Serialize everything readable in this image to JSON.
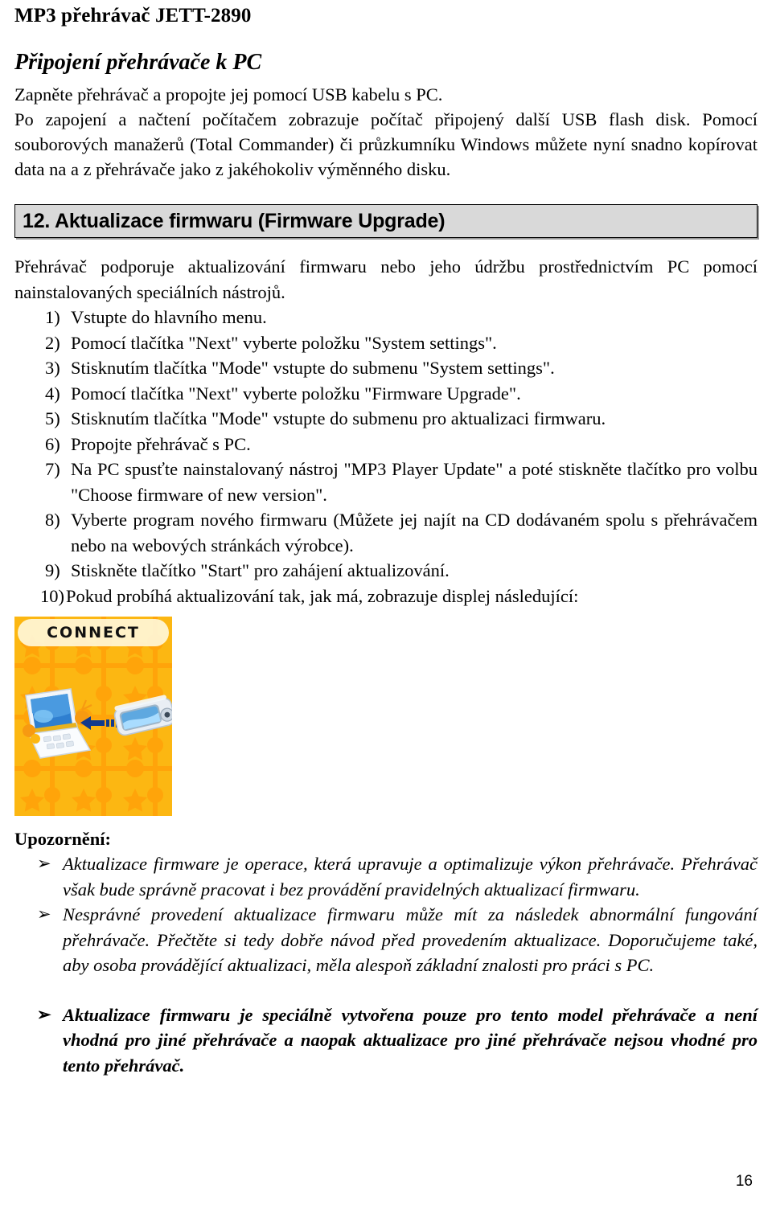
{
  "header": {
    "running_title": "MP3 přehrávač JETT-2890"
  },
  "section_connect": {
    "title": "Připojení přehrávače k PC",
    "paragraph_1": "Zapněte přehrávač a propojte jej pomocí USB kabelu s PC.",
    "paragraph_2": "Po zapojení a načtení počítačem zobrazuje počítač připojený další USB flash disk. Pomocí souborových manažerů (Total Commander) či průzkumníku Windows můžete nyní snadno kopírovat data na a z přehrávače jako z jakéhokoliv výměnného disku."
  },
  "section_firmware": {
    "banner_label": "12. Aktualizace firmwaru (Firmware Upgrade)",
    "intro": "Přehrávač podporuje aktualizování firmwaru nebo jeho údržbu prostřednictvím PC pomocí nainstalovaných speciálních nástrojů.",
    "steps": [
      {
        "marker": "1)",
        "text": "Vstupte do hlavního menu."
      },
      {
        "marker": "2)",
        "text": "Pomocí tlačítka \"Next\" vyberte položku \"System settings\"."
      },
      {
        "marker": "3)",
        "text": "Stisknutím tlačítka \"Mode\" vstupte do submenu \"System settings\"."
      },
      {
        "marker": "4)",
        "text": "Pomocí tlačítka \"Next\" vyberte položku \"Firmware Upgrade\"."
      },
      {
        "marker": "5)",
        "text": "Stisknutím tlačítka \"Mode\" vstupte do submenu pro aktualizaci firmwaru."
      },
      {
        "marker": "6)",
        "text": "Propojte přehrávač s PC."
      },
      {
        "marker": "7)",
        "text": "Na PC spusťte nainstalovaný nástroj \"MP3 Player Update\" a poté stiskněte tlačítko pro volbu \"Choose firmware of new version\"."
      },
      {
        "marker": "8)",
        "text": "Vyberte program nového firmwaru (Můžete jej najít na CD dodávaném spolu s přehrávačem nebo na webových stránkách výrobce)."
      },
      {
        "marker": "9)",
        "text": "Stiskněte tlačítko \"Start\" pro zahájení aktualizování."
      },
      {
        "marker": "10)",
        "text": "Pokud probíhá aktualizování tak, jak má, zobrazuje displej následující:"
      }
    ]
  },
  "device_screenshot": {
    "screen_title": "CONNECT",
    "background_color": "#fcb712",
    "puzzle_color": "#ffa40a",
    "star_color": "#ffa40a",
    "pill_color": "#fffae1",
    "laptop_icon": "laptop-icon",
    "player_icon": "mp3-player-icon",
    "transfer_arrow_icon": "left-arrow-icon"
  },
  "notices": {
    "label": "Upozornění:",
    "bullet_glyph": "➢",
    "items": [
      {
        "text": "Aktualizace firmware je operace, která upravuje a optimalizuje výkon přehrávače. Přehrávač však bude správně pracovat i bez provádění pravidelných aktualizací firmwaru.",
        "bold": false
      },
      {
        "text": "Nesprávné provedení aktualizace firmwaru může mít za následek abnormální fungování přehrávače. Přečtěte si tedy dobře návod před provedením aktualizace. Doporučujeme také, aby osoba provádějící aktualizaci, měla alespoň základní znalosti pro práci s PC.",
        "bold": false
      },
      {
        "text": "Aktualizace firmwaru je speciálně vytvořena pouze pro tento model přehrávače a není vhodná pro jiné přehrávače a naopak aktualizace pro jiné přehrávače nejsou vhodné pro tento přehrávač.",
        "bold": true
      }
    ]
  },
  "footer": {
    "page_number": "16"
  }
}
